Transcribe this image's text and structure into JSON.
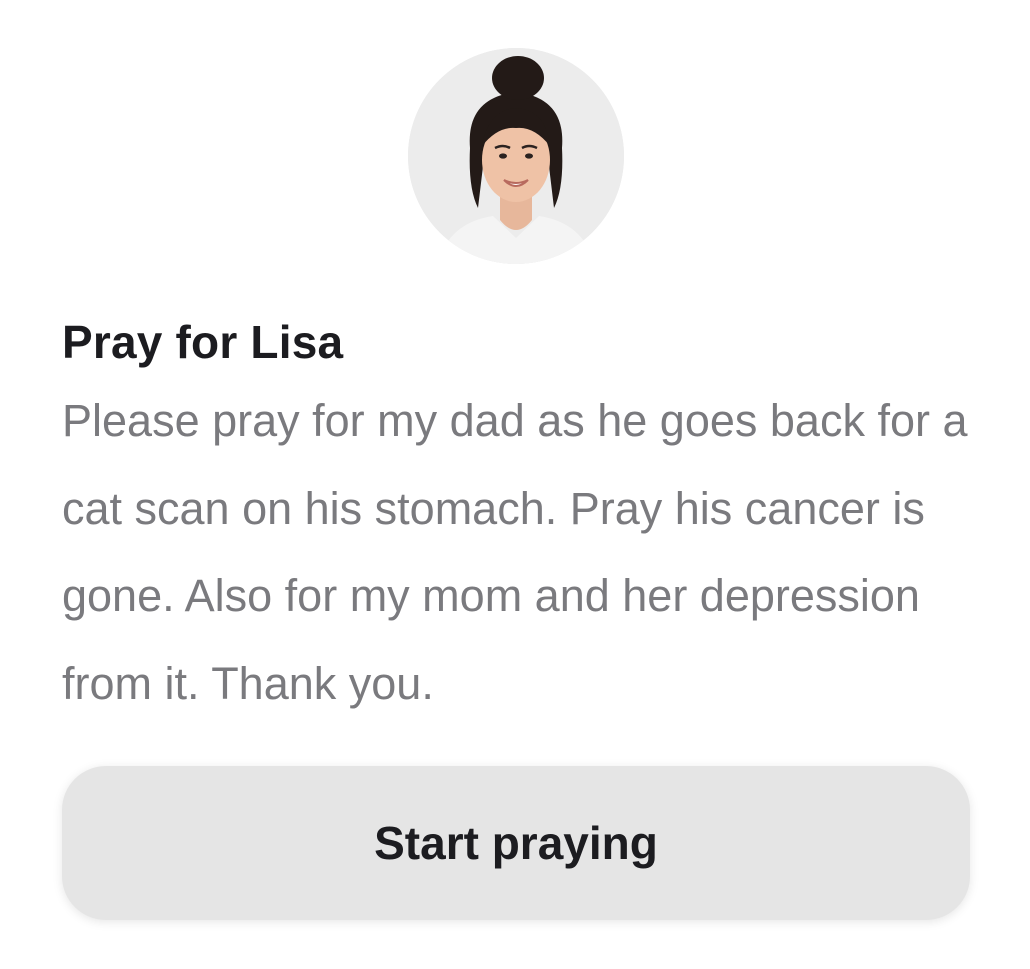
{
  "prayer_card": {
    "avatar_icon": "person-photo",
    "title": "Pray for Lisa",
    "body": "Please pray for my dad as he goes back for a cat scan on his stomach. Pray his cancer is gone. Also for my mom and her depression from it. Thank you.",
    "button_label": "Start praying"
  },
  "colors": {
    "background": "#ffffff",
    "title": "#1c1c20",
    "body": "#7a7a7e",
    "button_bg": "#e5e5e5"
  }
}
